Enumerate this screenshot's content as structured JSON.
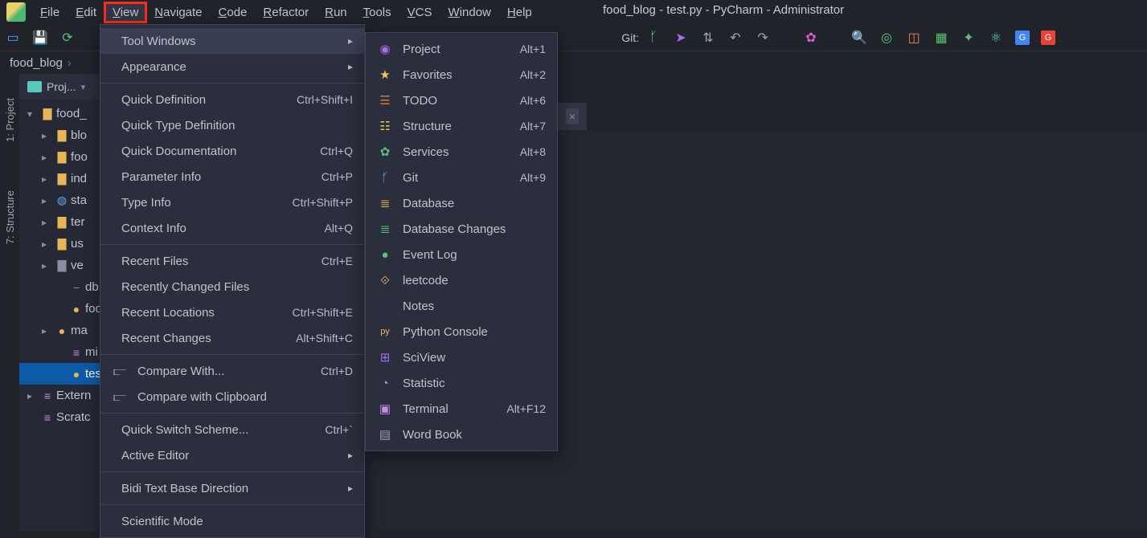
{
  "window_title": "food_blog - test.py - PyCharm - Administrator",
  "menubar": [
    "File",
    "Edit",
    "View",
    "Navigate",
    "Code",
    "Refactor",
    "Run",
    "Tools",
    "VCS",
    "Window",
    "Help"
  ],
  "menubar_active_index": 2,
  "toolbar_git_label": "Git:",
  "breadcrumb": [
    "food_blog"
  ],
  "project_header_label": "Proj...",
  "left_gutter_tabs": [
    "1: Project",
    "7: Structure"
  ],
  "tree": [
    {
      "depth": 0,
      "chev": "▾",
      "icon": "folder",
      "cls": "fi-folder",
      "label": "food_"
    },
    {
      "depth": 1,
      "chev": "▸",
      "icon": "folder",
      "cls": "fi-folder",
      "label": "blo"
    },
    {
      "depth": 1,
      "chev": "▸",
      "icon": "folder",
      "cls": "fi-folder",
      "label": "foo"
    },
    {
      "depth": 1,
      "chev": "▸",
      "icon": "folder",
      "cls": "fi-folder",
      "label": "ind"
    },
    {
      "depth": 1,
      "chev": "▸",
      "icon": "globe",
      "cls": "fi-globe",
      "label": "sta"
    },
    {
      "depth": 1,
      "chev": "▸",
      "icon": "folder",
      "cls": "fi-folder",
      "label": "ter"
    },
    {
      "depth": 1,
      "chev": "▸",
      "icon": "folder",
      "cls": "fi-folder",
      "label": "us"
    },
    {
      "depth": 1,
      "chev": "▸",
      "icon": "folder",
      "cls": "fi-folder-grey",
      "label": "ve"
    },
    {
      "depth": 2,
      "chev": "",
      "icon": "db",
      "cls": "fi-db",
      "label": "db"
    },
    {
      "depth": 2,
      "chev": "",
      "icon": "py",
      "cls": "fi-py",
      "label": "foo"
    },
    {
      "depth": 1,
      "chev": "▸",
      "icon": "py",
      "cls": "fi-py",
      "label": "ma"
    },
    {
      "depth": 2,
      "chev": "",
      "icon": "list",
      "cls": "fi-list",
      "label": "mi"
    },
    {
      "depth": 2,
      "chev": "",
      "icon": "py",
      "cls": "fi-py",
      "label": "tes",
      "selected": true
    },
    {
      "depth": 0,
      "chev": "▸",
      "icon": "list",
      "cls": "fi-list",
      "label": "Extern"
    },
    {
      "depth": 0,
      "chev": "",
      "icon": "list",
      "cls": "fi-list",
      "label": "Scratc"
    }
  ],
  "editor_tab_close": "×",
  "view_menu": [
    {
      "label": "Tool Windows",
      "arrow": true,
      "active": true
    },
    {
      "label": "Appearance",
      "arrow": true
    },
    {
      "sep": true
    },
    {
      "label": "Quick Definition",
      "shortcut": "Ctrl+Shift+I"
    },
    {
      "label": "Quick Type Definition"
    },
    {
      "label": "Quick Documentation",
      "shortcut": "Ctrl+Q"
    },
    {
      "label": "Parameter Info",
      "shortcut": "Ctrl+P"
    },
    {
      "label": "Type Info",
      "shortcut": "Ctrl+Shift+P"
    },
    {
      "label": "Context Info",
      "shortcut": "Alt+Q"
    },
    {
      "sep": true
    },
    {
      "label": "Recent Files",
      "shortcut": "Ctrl+E"
    },
    {
      "label": "Recently Changed Files"
    },
    {
      "label": "Recent Locations",
      "shortcut": "Ctrl+Shift+E"
    },
    {
      "label": "Recent Changes",
      "shortcut": "Alt+Shift+C"
    },
    {
      "sep": true
    },
    {
      "label": "Compare With...",
      "shortcut": "Ctrl+D",
      "icon": "⫍",
      "iconcls": ""
    },
    {
      "label": "Compare with Clipboard",
      "icon": "⫍",
      "iconcls": ""
    },
    {
      "sep": true
    },
    {
      "label": "Quick Switch Scheme...",
      "shortcut": "Ctrl+`"
    },
    {
      "label": "Active Editor",
      "arrow": true
    },
    {
      "sep": true
    },
    {
      "label": "Bidi Text Base Direction",
      "arrow": true
    },
    {
      "sep": true
    },
    {
      "label": "Scientific Mode"
    }
  ],
  "tool_windows_menu": [
    {
      "icon": "◉",
      "iconcls": "ic-project",
      "label": "Project",
      "shortcut": "Alt+1"
    },
    {
      "icon": "★",
      "iconcls": "ic-star",
      "label": "Favorites",
      "shortcut": "Alt+2"
    },
    {
      "icon": "☰",
      "iconcls": "ic-todo",
      "label": "TODO",
      "shortcut": "Alt+6"
    },
    {
      "icon": "☷",
      "iconcls": "ic-struct",
      "label": "Structure",
      "shortcut": "Alt+7"
    },
    {
      "icon": "✿",
      "iconcls": "ic-gear",
      "label": "Services",
      "shortcut": "Alt+8"
    },
    {
      "icon": "ᚶ",
      "iconcls": "ic-git",
      "label": "Git",
      "shortcut": "Alt+9"
    },
    {
      "icon": "≣",
      "iconcls": "ic-db",
      "label": "Database"
    },
    {
      "icon": "≣",
      "iconcls": "ic-dbch",
      "label": "Database Changes"
    },
    {
      "icon": "●",
      "iconcls": "ic-event",
      "label": "Event Log"
    },
    {
      "icon": "⟐",
      "iconcls": "ic-leet",
      "label": "leetcode"
    },
    {
      "icon": "",
      "iconcls": "",
      "label": "Notes"
    },
    {
      "icon": "py",
      "iconcls": "ic-pycon",
      "label": "Python Console"
    },
    {
      "icon": "⊞",
      "iconcls": "ic-sci",
      "label": "SciView"
    },
    {
      "icon": "◔",
      "iconcls": "ic-stat",
      "label": "Statistic"
    },
    {
      "icon": "▣",
      "iconcls": "ic-term",
      "label": "Terminal",
      "shortcut": "Alt+F12"
    },
    {
      "icon": "▤",
      "iconcls": "ic-word",
      "label": "Word Book"
    }
  ]
}
